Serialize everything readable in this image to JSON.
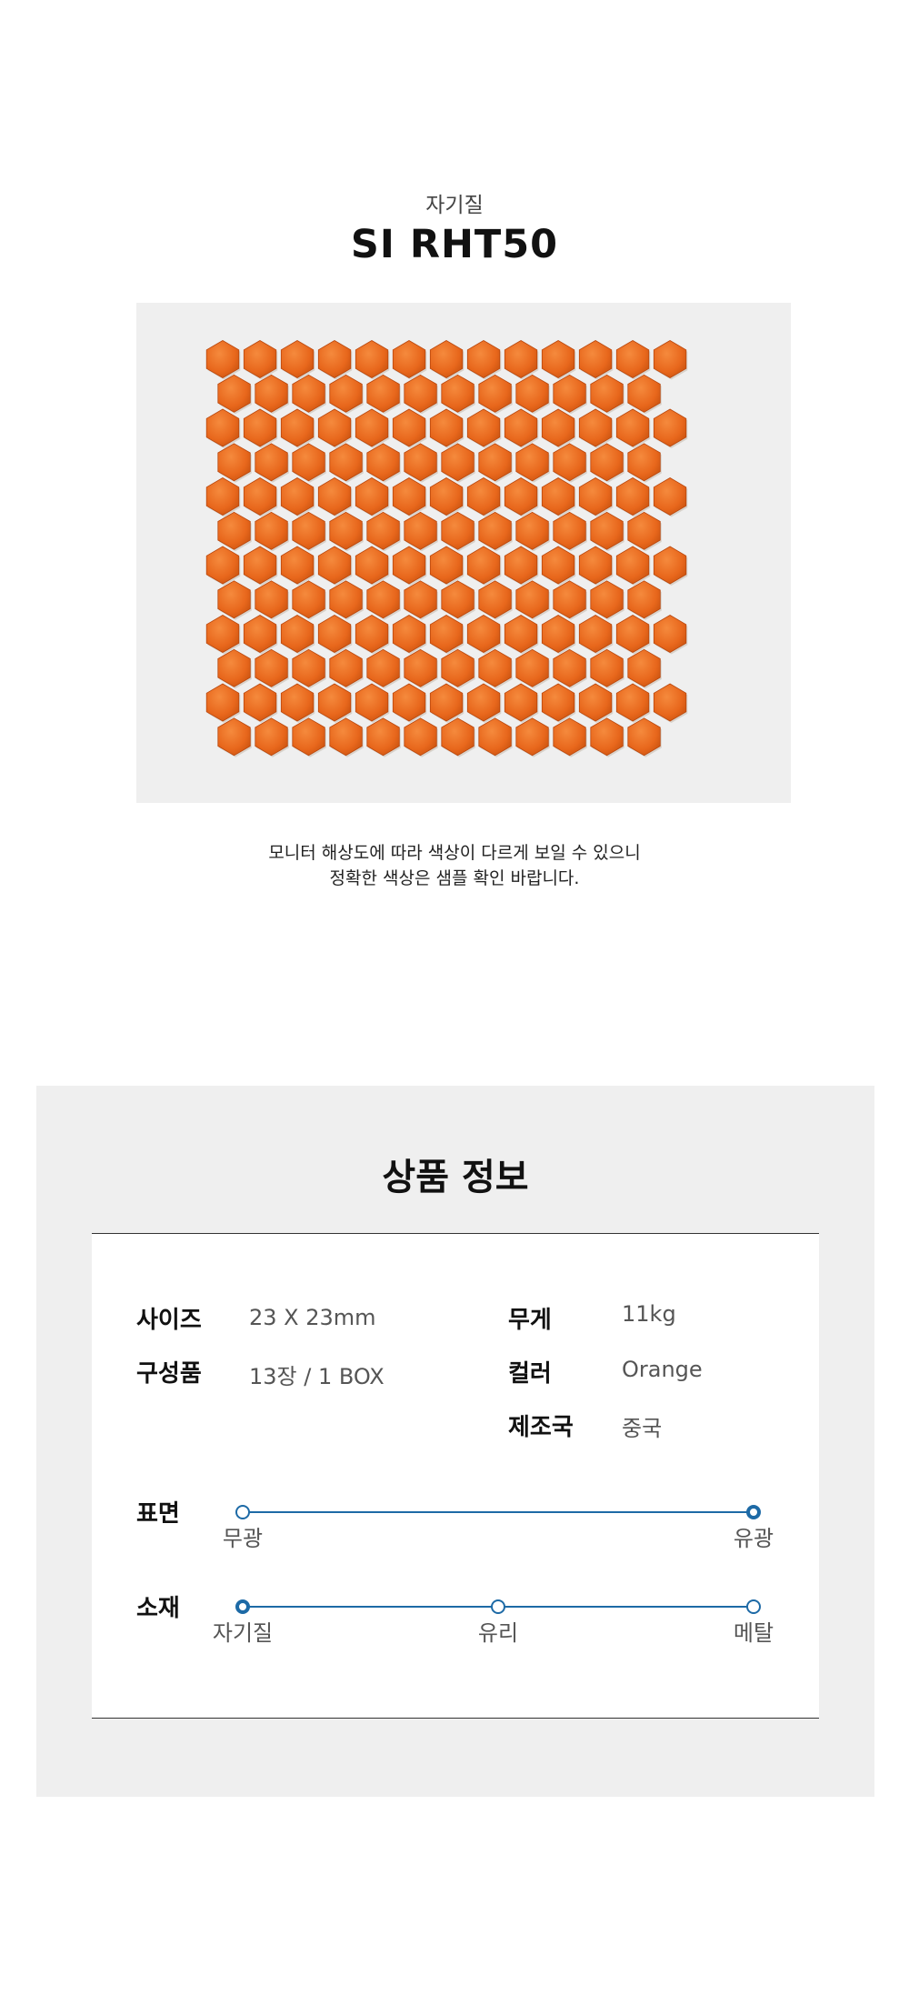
{
  "header": {
    "category": "자기질",
    "product_name": "SI RHT50"
  },
  "product_image": {
    "alt": "orange hexagon mosaic tile sheet",
    "tile_color": "#e8671c",
    "tile_highlight": "#f58a3d",
    "grout_color": "#d8d2cb",
    "background_color": "#efefef"
  },
  "notice": {
    "line1": "모니터 해상도에 따라 색상이 다르게 보일 수 있으니",
    "line2": "정확한 색상은 샘플 확인 바랍니다."
  },
  "info": {
    "heading": "상품 정보",
    "specs": {
      "size_label": "사이즈",
      "size_value": "23 X 23mm",
      "weight_label": "무게",
      "weight_value": "11kg",
      "composition_label": "구성품",
      "composition_value": "13장 / 1 BOX",
      "color_label": "컬러",
      "color_value": "Orange",
      "origin_label": "제조국",
      "origin_value": "중국"
    },
    "surface": {
      "label": "표면",
      "options": [
        "무광",
        "유광"
      ],
      "selected_index": 1
    },
    "material": {
      "label": "소재",
      "options": [
        "자기질",
        "유리",
        "메탈"
      ],
      "selected_index": 0
    },
    "accent_color": "#1d6aa6"
  }
}
